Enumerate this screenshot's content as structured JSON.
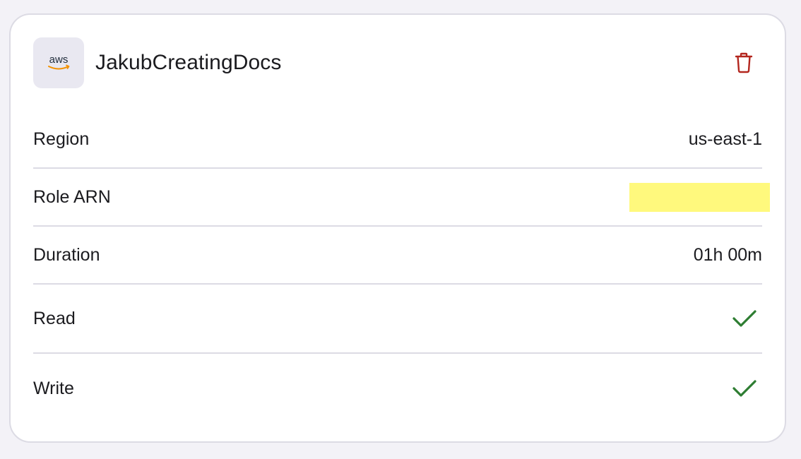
{
  "connection": {
    "name": "JakubCreatingDocs",
    "logo_text": "aws",
    "delete_icon": "trash-icon"
  },
  "details": {
    "region_label": "Region",
    "region_value": "us-east-1",
    "role_arn_label": "Role ARN",
    "duration_label": "Duration",
    "duration_value": "01h 00m",
    "read_label": "Read",
    "read_enabled": true,
    "write_label": "Write",
    "write_enabled": true
  },
  "colors": {
    "danger": "#b3261e",
    "success": "#2e7d32",
    "redaction": "#fff97d",
    "aws_orange": "#f29100"
  }
}
